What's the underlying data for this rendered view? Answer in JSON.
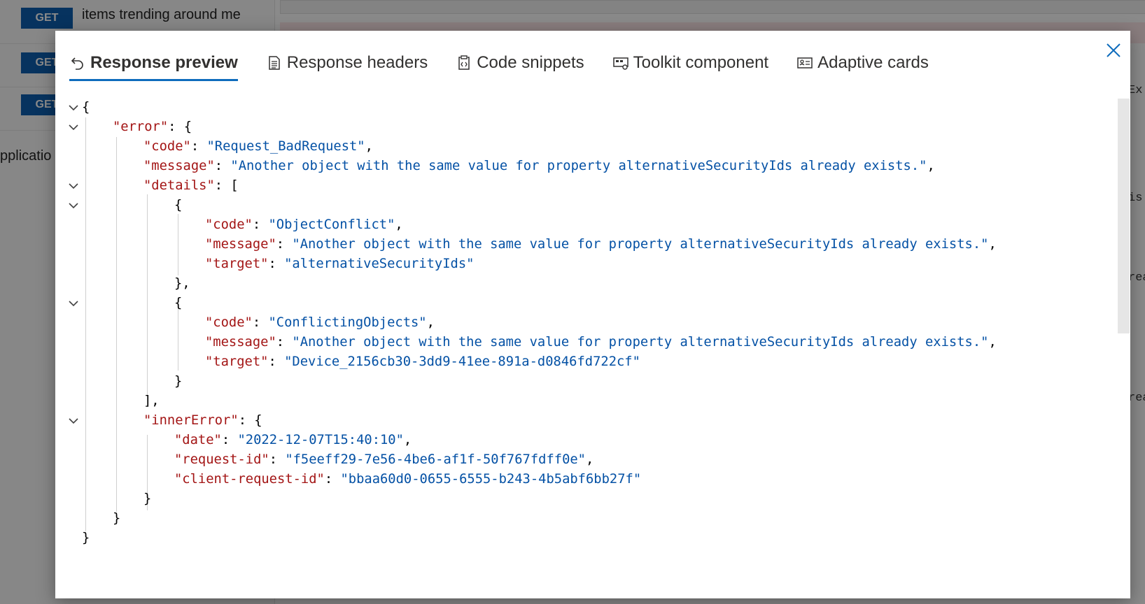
{
  "background": {
    "requests": [
      {
        "method": "GET",
        "label": "items trending around me"
      },
      {
        "method": "GET",
        "label": ""
      },
      {
        "method": "GET",
        "label": ""
      }
    ],
    "section_fragment": "pplicatio",
    "right_fragments": [
      "Ex",
      "is",
      "rea",
      "rea"
    ]
  },
  "modal": {
    "tabs": [
      {
        "label": "Response preview",
        "icon": "undo-arrow-icon",
        "active": true
      },
      {
        "label": "Response headers",
        "icon": "document-list-icon"
      },
      {
        "label": "Code snippets",
        "icon": "clipboard-code-icon"
      },
      {
        "label": "Toolkit component",
        "icon": "component-icon"
      },
      {
        "label": "Adaptive cards",
        "icon": "contact-card-icon"
      }
    ],
    "close_icon": "close-icon",
    "colors": {
      "key": "#a31515",
      "string": "#0451a5",
      "accent": "#0f6cbd",
      "get_badge": "#0e5fb0"
    }
  },
  "json": {
    "l01": "{",
    "l02k": "\"error\"",
    "l02p": ": {",
    "l03k": "\"code\"",
    "l03s": "\"Request_BadRequest\"",
    "l04k": "\"message\"",
    "l04s": "\"Another object with the same value for property alternativeSecurityIds already exists.\"",
    "l05k": "\"details\"",
    "l05p": ": [",
    "l06": "{",
    "l07k": "\"code\"",
    "l07s": "\"ObjectConflict\"",
    "l08k": "\"message\"",
    "l08s": "\"Another object with the same value for property alternativeSecurityIds already exists.\"",
    "l09k": "\"target\"",
    "l09s": "\"alternativeSecurityIds\"",
    "l10": "},",
    "l11": "{",
    "l12k": "\"code\"",
    "l12s": "\"ConflictingObjects\"",
    "l13k": "\"message\"",
    "l13s": "\"Another object with the same value for property alternativeSecurityIds already exists.\"",
    "l14k": "\"target\"",
    "l14s": "\"Device_2156cb30-3dd9-41ee-891a-d0846fd722cf\"",
    "l15": "}",
    "l16": "],",
    "l17k": "\"innerError\"",
    "l17p": ": {",
    "l18k": "\"date\"",
    "l18s": "\"2022-12-07T15:40:10\"",
    "l19k": "\"request-id\"",
    "l19s": "\"f5eeff29-7e56-4be6-af1f-50f767fdff0e\"",
    "l20k": "\"client-request-id\"",
    "l20s": "\"bbaa60d0-0655-6555-b243-4b5abf6bb27f\"",
    "l21": "}",
    "l22": "}",
    "l23": "}"
  }
}
